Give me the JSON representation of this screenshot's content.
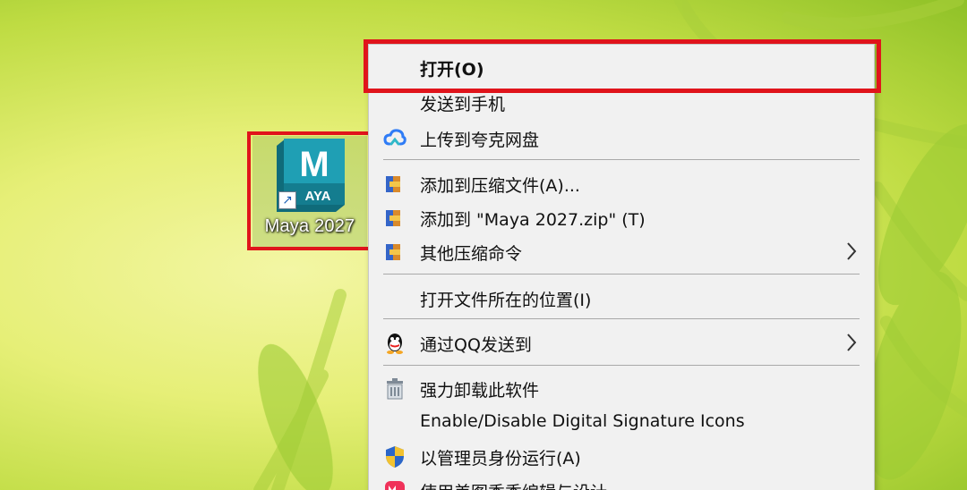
{
  "desktop": {
    "shortcut": {
      "name": "Maya 2027",
      "icon": "maya-app-icon",
      "icon_letter": "M",
      "icon_badge": "AYA",
      "overlay_icon": "shortcut-arrow-icon"
    }
  },
  "context_menu": {
    "items": [
      {
        "label": "打开(O)",
        "icon": null
      },
      {
        "label": "发送到手机",
        "icon": null
      },
      {
        "label": "上传到夸克网盘",
        "icon": "quark-cloud-icon"
      },
      {
        "label": "添加到压缩文件(A)...",
        "icon": "winrar-archive-icon"
      },
      {
        "label": "添加到 \"Maya 2027.zip\" (T)",
        "icon": "winrar-archive-icon"
      },
      {
        "label": "其他压缩命令",
        "icon": "winrar-archive-icon",
        "submenu": true
      },
      {
        "label": "打开文件所在的位置(I)",
        "icon": null
      },
      {
        "label": "通过QQ发送到",
        "icon": "qq-penguin-icon",
        "submenu": true
      },
      {
        "label": "强力卸载此软件",
        "icon": "trash-bin-icon"
      },
      {
        "label": "Enable/Disable Digital Signature Icons",
        "icon": null
      },
      {
        "label": "以管理员身份运行(A)",
        "icon": "uac-shield-icon"
      },
      {
        "label": "使用美图秀秀编辑与设计",
        "icon": "meitu-icon"
      }
    ]
  },
  "colors": {
    "highlight_border": "#e0141b",
    "menu_background": "#f1f1f1",
    "maya_teal": "#1b8fa3",
    "quark_blue": "#2f7cf6"
  }
}
